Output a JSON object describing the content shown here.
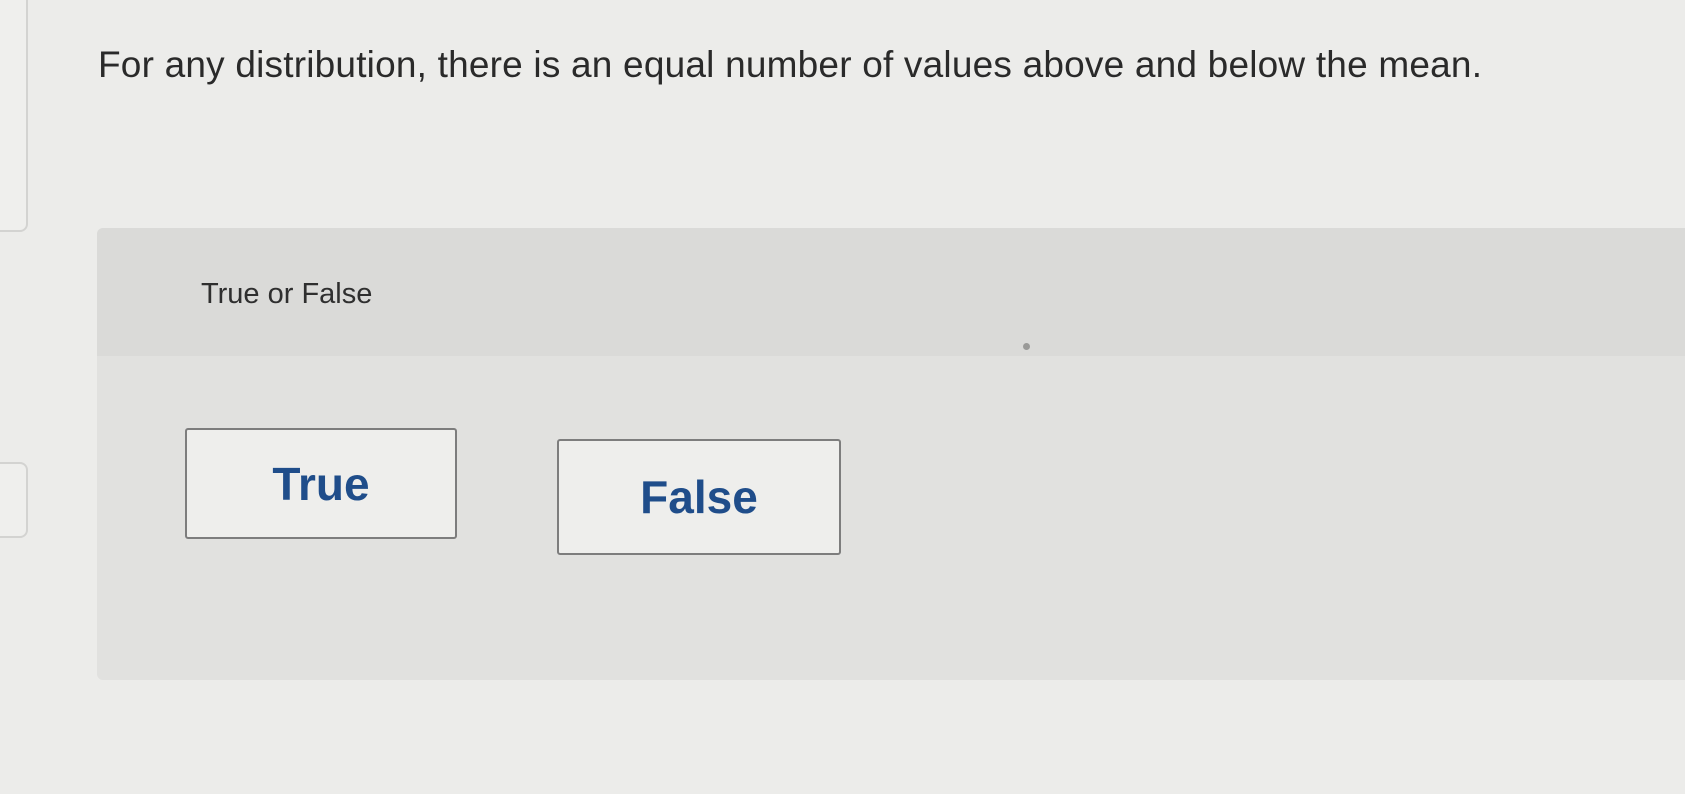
{
  "question": {
    "text": "For any distribution, there is an equal number of values above and below the mean."
  },
  "answer_panel": {
    "prompt": "True or False",
    "choices": [
      {
        "label": "True"
      },
      {
        "label": "False"
      }
    ]
  },
  "colors": {
    "page_background": "#ececea",
    "panel_background": "#e1e1df",
    "button_text": "#1f4d8a",
    "button_border": "#7d7d7d"
  }
}
